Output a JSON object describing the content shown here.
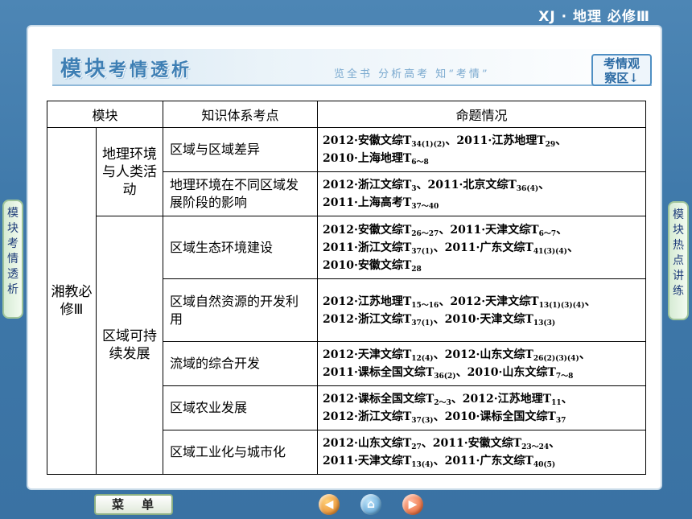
{
  "course_label": "XJ · 地理  必修Ⅲ",
  "section_title": {
    "part1": "模块",
    "part2": "考情透析"
  },
  "slogan": "览全书  分析高考  知“考情”",
  "observe_button": {
    "line1": "考情观",
    "line2": "察区↓"
  },
  "side_tab_left": "模块考情透析",
  "side_tab_right": "模块热点讲练",
  "table": {
    "headers": [
      "模块",
      "知识体系考点",
      "命题情况"
    ],
    "module": "湘教必修Ⅲ",
    "groups": [
      {
        "name": "地理环境与人类活动",
        "rows": [
          {
            "point": "区域与区域差异",
            "exam": [
              [
                "2012·安徽文综T",
                "34(1)(2)",
                "、2011·江苏地理T",
                "29",
                "、"
              ],
              [
                "2010·上海地理T",
                "6～8"
              ]
            ]
          },
          {
            "point": "地理环境在不同区域发展阶段的影响",
            "exam": [
              [
                "2012·浙江文综T",
                "3",
                "、2011·北京文综T",
                "36(4)",
                "、"
              ],
              [
                "2011·上海高考T",
                "37～40"
              ]
            ]
          }
        ]
      },
      {
        "name": "区域可持续发展",
        "rows": [
          {
            "point": "区域生态环境建设",
            "exam": [
              [
                "2012·安徽文综T",
                "26～27",
                "、2011·天津文综T",
                "6～7",
                "、"
              ],
              [
                "2011·浙江文综T",
                "37(1)",
                "、2011·广东文综T",
                "41(3)(4)",
                "、"
              ],
              [
                "2010·安徽文综T",
                "28"
              ]
            ]
          },
          {
            "point": "区域自然资源的开发利用",
            "exam": [
              [
                "2012·江苏地理T",
                "15～16",
                "、2012·天津文综T",
                "13(1)(3)(4)",
                "、"
              ],
              [
                "2012·浙江文综T",
                "37(1)",
                "、2010·天津文综T",
                "13(3)"
              ]
            ]
          },
          {
            "point": "流域的综合开发",
            "exam": [
              [
                "2012·天津文综T",
                "12(4)",
                "、2012·山东文综T",
                "26(2)(3)(4)",
                "、"
              ],
              [
                "2011·课标全国文综T",
                "36(2)",
                "、2010·山东文综T",
                "7～8"
              ]
            ]
          },
          {
            "point": "区域农业发展",
            "exam": [
              [
                "2012·课标全国文综T",
                "2～3",
                "、2012·江苏地理T",
                "11",
                "、"
              ],
              [
                "2012·浙江文综T",
                "37(3)",
                "、2010·课标全国文综T",
                "37"
              ]
            ]
          },
          {
            "point": "区域工业化与城市化",
            "exam": [
              [
                "2012·山东文综T",
                "27",
                "、2011·安徽文综T",
                "23～24",
                "、"
              ],
              [
                "2011·天津文综T",
                "13(4)",
                "、2011·广东文综T",
                "40(5)"
              ]
            ]
          }
        ]
      }
    ]
  },
  "menu_button": "菜单",
  "icons": {
    "prev": "prev-arrow-icon",
    "home": "home-icon",
    "next": "next-arrow-icon"
  },
  "colors": {
    "background": "#3f79aa",
    "accent": "#3e7fb4"
  }
}
